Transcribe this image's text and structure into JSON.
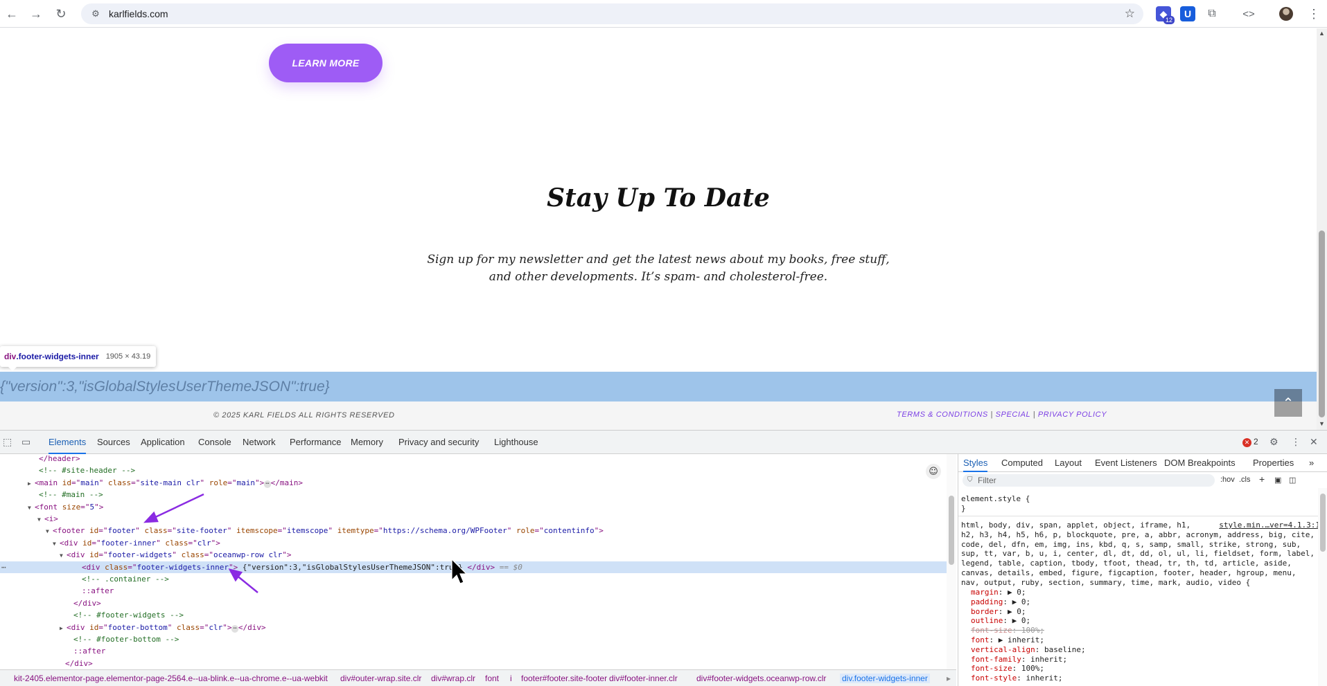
{
  "browser": {
    "url": "karlfields.com",
    "extension_badge": "12"
  },
  "page": {
    "learn_more": "LEARN MORE",
    "stay_title": "Stay Up To Date",
    "stay_text": "Sign up for my newsletter and get the latest news about my books, free stuff, and other developments. It’s spam- and cholesterol-free.",
    "highlight_text": "{\"version\":3,\"isGlobalStylesUserThemeJSON\":true}",
    "copyright": "© 2025 KARL FIELDS ALL RIGHTS RESERVED",
    "links": {
      "terms": "TERMS & CONDITIONS",
      "special": "SPECIAL",
      "privacy": "PRIVACY POLICY",
      "sep": " | "
    }
  },
  "inspector_tooltip": {
    "tag": "div",
    "cls": ".footer-widgets-inner",
    "dims": "1905 × 43.19"
  },
  "devtools": {
    "tabs": [
      "Elements",
      "Sources",
      "Application",
      "Console",
      "Network",
      "Performance",
      "Memory",
      "Privacy and security",
      "Lighthouse"
    ],
    "error_count": "2",
    "elements": [
      {
        "t": [
          [
            "t-tag",
            "</header>"
          ]
        ]
      },
      {
        "t": [
          [
            "t-com",
            "<!-- #site-header -->"
          ]
        ]
      },
      {
        "t": [
          [
            "t-tag",
            "<main "
          ],
          [
            "t-attr",
            "id"
          ],
          [
            "t-tag",
            "=\""
          ],
          [
            "t-val",
            "main"
          ],
          [
            "t-tag",
            "\" "
          ],
          [
            "t-attr",
            "class"
          ],
          [
            "t-tag",
            "=\""
          ],
          [
            "t-val",
            "site-main clr"
          ],
          [
            "t-tag",
            "\" "
          ],
          [
            "t-attr",
            "role"
          ],
          [
            "t-tag",
            "=\""
          ],
          [
            "t-val",
            "main"
          ],
          [
            "t-tag",
            "\">"
          ],
          [
            "ellip",
            "⋯"
          ],
          [
            "t-tag",
            "</main>"
          ]
        ]
      },
      {
        "t": [
          [
            "t-com",
            "<!-- #main -->"
          ]
        ]
      },
      {
        "t": [
          [
            "t-tag",
            "<font "
          ],
          [
            "t-attr",
            "size"
          ],
          [
            "t-tag",
            "=\""
          ],
          [
            "t-val",
            "5"
          ],
          [
            "t-tag",
            "\">"
          ]
        ]
      },
      {
        "t": [
          [
            "t-tag",
            "<i>"
          ]
        ]
      },
      {
        "t": [
          [
            "t-tag",
            "<footer "
          ],
          [
            "t-attr",
            "id"
          ],
          [
            "t-tag",
            "=\""
          ],
          [
            "t-val",
            "footer"
          ],
          [
            "t-tag",
            "\" "
          ],
          [
            "t-attr",
            "class"
          ],
          [
            "t-tag",
            "=\""
          ],
          [
            "t-val",
            "site-footer"
          ],
          [
            "t-tag",
            "\" "
          ],
          [
            "t-attr",
            "itemscope"
          ],
          [
            "t-tag",
            "=\""
          ],
          [
            "t-val",
            "itemscope"
          ],
          [
            "t-tag",
            "\" "
          ],
          [
            "t-attr",
            "itemtype"
          ],
          [
            "t-tag",
            "=\""
          ],
          [
            "t-val",
            "https://schema.org/WPFooter"
          ],
          [
            "t-tag",
            "\" "
          ],
          [
            "t-attr",
            "role"
          ],
          [
            "t-tag",
            "=\""
          ],
          [
            "t-val",
            "contentinfo"
          ],
          [
            "t-tag",
            "\">"
          ]
        ]
      },
      {
        "t": [
          [
            "t-tag",
            "<div "
          ],
          [
            "t-attr",
            "id"
          ],
          [
            "t-tag",
            "=\""
          ],
          [
            "t-val",
            "footer-inner"
          ],
          [
            "t-tag",
            "\" "
          ],
          [
            "t-attr",
            "class"
          ],
          [
            "t-tag",
            "=\""
          ],
          [
            "t-val",
            "clr"
          ],
          [
            "t-tag",
            "\">"
          ]
        ]
      },
      {
        "t": [
          [
            "t-tag",
            "<div "
          ],
          [
            "t-attr",
            "id"
          ],
          [
            "t-tag",
            "=\""
          ],
          [
            "t-val",
            "footer-widgets"
          ],
          [
            "t-tag",
            "\" "
          ],
          [
            "t-attr",
            "class"
          ],
          [
            "t-tag",
            "=\""
          ],
          [
            "t-val",
            "oceanwp-row clr"
          ],
          [
            "t-tag",
            "\">"
          ]
        ]
      },
      {
        "t": [
          [
            "t-tag",
            "<div "
          ],
          [
            "t-attr",
            "class"
          ],
          [
            "t-tag",
            "=\""
          ],
          [
            "t-val",
            "footer-widgets-inner"
          ],
          [
            "t-tag",
            "\">"
          ],
          [
            "t-txt",
            " {\"version\":3,\"isGlobalStylesUserThemeJSON\":true} "
          ],
          [
            "t-tag",
            "</div>"
          ],
          [
            "t-dim",
            " == $0"
          ]
        ]
      },
      {
        "t": [
          [
            "t-com",
            "<!-- .container -->"
          ]
        ]
      },
      {
        "t": [
          [
            "t-tag",
            "::after"
          ]
        ]
      },
      {
        "t": [
          [
            "t-tag",
            "</div>"
          ]
        ]
      },
      {
        "t": [
          [
            "t-com",
            "<!-- #footer-widgets -->"
          ]
        ]
      },
      {
        "t": [
          [
            "t-tag",
            "<div "
          ],
          [
            "t-attr",
            "id"
          ],
          [
            "t-tag",
            "=\""
          ],
          [
            "t-val",
            "footer-bottom"
          ],
          [
            "t-tag",
            "\" "
          ],
          [
            "t-attr",
            "class"
          ],
          [
            "t-tag",
            "=\""
          ],
          [
            "t-val",
            "clr"
          ],
          [
            "t-tag",
            "\">"
          ],
          [
            "ellip",
            "⋯"
          ],
          [
            "t-tag",
            "</div>"
          ]
        ]
      },
      {
        "t": [
          [
            "t-com",
            "<!-- #footer-bottom -->"
          ]
        ]
      },
      {
        "t": [
          [
            "t-tag",
            "::after"
          ]
        ]
      },
      {
        "t": [
          [
            "t-tag",
            "</div>"
          ]
        ]
      }
    ],
    "breadcrumbs": [
      "kit-2405.elementor-page.elementor-page-2564.e--ua-blink.e--ua-chrome.e--ua-webkit",
      "div#outer-wrap.site.clr",
      "div#wrap.clr",
      "font",
      "i",
      "footer#footer.site-footer",
      "div#footer-inner.clr",
      "div#footer-widgets.oceanwp-row.clr",
      "div.footer-widgets-inner"
    ],
    "styles_tabs": [
      "Styles",
      "Computed",
      "Layout",
      "Event Listeners",
      "DOM Breakpoints",
      "Properties"
    ],
    "filter_placeholder": "Filter",
    "filter_tools": [
      ":hov",
      ".cls",
      "+"
    ],
    "element_style": [
      "element.style {",
      "}"
    ],
    "selector_lines": [
      "html, body, div, span, applet, object, iframe, h1,",
      "h2, h3, h4, h5, h6, p, blockquote, pre, a, abbr, acronym, address, big, cite,",
      "code, del, dfn, em, img, ins, kbd, q, s, samp, small, strike, strong, sub,",
      "sup, tt, var, b, u, i, center, dl, dt, dd, ol, ul, li, fieldset, form, label,",
      "legend, table, caption, tbody, tfoot, thead, tr, th, td, article, aside,",
      "canvas, details, embed, figure, figcaption, footer, header, hgroup, menu,",
      "nav, output, ruby, section, summary, time, mark, audio, video {"
    ],
    "style_source": "style.min.…ver=4.1.3:1",
    "css_props": [
      {
        "p": "margin",
        "v": "▶ 0;",
        "strike": false
      },
      {
        "p": "padding",
        "v": "▶ 0;",
        "strike": false
      },
      {
        "p": "border",
        "v": "▶ 0;",
        "strike": false
      },
      {
        "p": "outline",
        "v": "▶ 0;",
        "strike": false
      },
      {
        "p": "font-size",
        "v": "100%;",
        "strike": true
      },
      {
        "p": "font",
        "v": "▶ inherit;",
        "strike": false
      },
      {
        "p": "vertical-align",
        "v": "baseline;",
        "strike": false
      },
      {
        "p": "font-family",
        "v": "inherit;",
        "strike": false
      },
      {
        "p": "font-size",
        "v": "100%;",
        "strike": false
      },
      {
        "p": "font-style",
        "v": "inherit;",
        "strike": false
      }
    ]
  }
}
